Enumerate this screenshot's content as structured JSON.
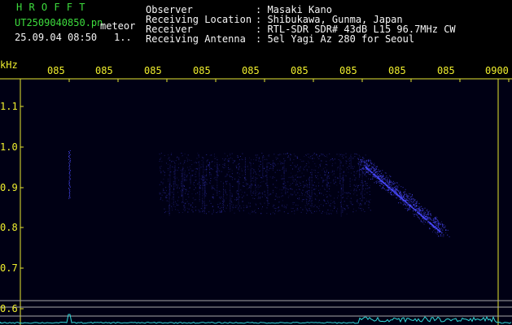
{
  "header": {
    "app_name": "H R O F F T",
    "file_name": "UT2509040850.pn",
    "tag": "meteor",
    "timestamp": "25.09.04 08:50",
    "page_indicator": "1..",
    "fields": [
      {
        "label": "Observer",
        "value": ": Masaki Kano"
      },
      {
        "label": "Receiving Location",
        "value": ": Shibukawa, Gunma, Japan"
      },
      {
        "label": "Receiver",
        "value": ": RTL-SDR SDR# 43dB L15 96.7MHz CW"
      },
      {
        "label": "Receiving Antenna",
        "value": ": 5el Yagi Az 280 for Seoul"
      }
    ]
  },
  "time_axis": {
    "labels": [
      "085",
      "085",
      "085",
      "085",
      "085",
      "085",
      "085",
      "085",
      "085",
      "0900"
    ]
  },
  "freq_axis": {
    "unit": "kHz",
    "labels": [
      "1.1",
      "1.0",
      "0.9",
      "0.8",
      "0.7",
      "0.6"
    ]
  },
  "colors": {
    "background": "#000000",
    "plot_background": "#000014",
    "signal": "#4a4aff",
    "grid": "#a8a8a8",
    "frame_yellow": "#e8e830",
    "level_trace": "#30d8d8"
  }
}
